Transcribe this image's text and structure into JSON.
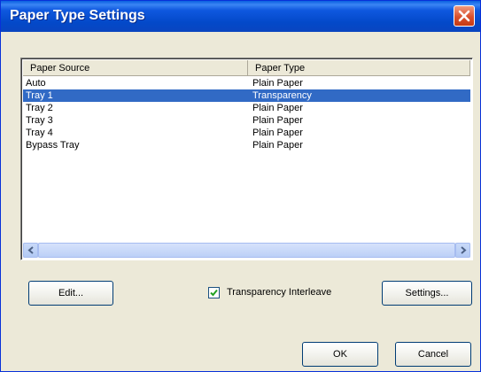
{
  "window": {
    "title": "Paper Type Settings",
    "close_icon": "close-icon"
  },
  "table": {
    "columns": [
      "Paper Source",
      "Paper Type"
    ],
    "rows": [
      {
        "source": "Auto",
        "type": "Plain Paper",
        "selected": false
      },
      {
        "source": "Tray 1",
        "type": "Transparency",
        "selected": true
      },
      {
        "source": "Tray 2",
        "type": "Plain Paper",
        "selected": false
      },
      {
        "source": "Tray 3",
        "type": "Plain Paper",
        "selected": false
      },
      {
        "source": "Tray 4",
        "type": "Plain Paper",
        "selected": false
      },
      {
        "source": "Bypass Tray",
        "type": "Plain Paper",
        "selected": false
      }
    ]
  },
  "buttons": {
    "edit": "Edit...",
    "settings": "Settings...",
    "ok": "OK",
    "cancel": "Cancel"
  },
  "checkbox": {
    "label": "Transparency Interleave",
    "checked": true
  },
  "colors": {
    "title_bar": "#0349c9",
    "selection": "#316ac5",
    "dialog_bg": "#ece9d8",
    "close_button": "#d9502d"
  }
}
